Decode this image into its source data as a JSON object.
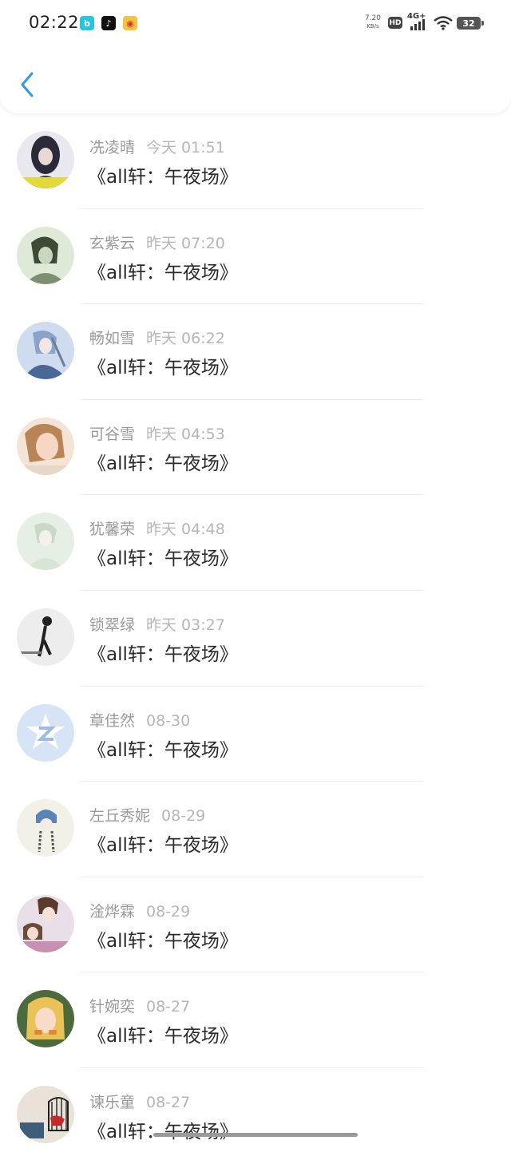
{
  "status_bar": {
    "time": "02:22",
    "apps": [
      "b",
      "♪",
      "◉"
    ],
    "net_speed_value": "7.20",
    "net_speed_unit": "KB/s",
    "hd": "HD",
    "network": "4G+",
    "battery": "32"
  },
  "header": {
    "back_icon": "chevron-left-icon",
    "accent": "#2f9be8"
  },
  "messages": [
    {
      "name": "冼凌晴",
      "time": "今天 01:51",
      "text": "《all轩：午夜场》",
      "avatar": "avatar-dark-haired-girl"
    },
    {
      "name": "玄紫云",
      "time": "昨天 07:20",
      "text": "《all轩：午夜场》",
      "avatar": "avatar-green-sketch"
    },
    {
      "name": "畅如雪",
      "time": "昨天 06:22",
      "text": "《all轩：午夜场》",
      "avatar": "avatar-blue-anime"
    },
    {
      "name": "可谷雪",
      "time": "昨天 04:53",
      "text": "《all轩：午夜场》",
      "avatar": "avatar-selfie-girl"
    },
    {
      "name": "犹馨荣",
      "time": "昨天 04:48",
      "text": "《all轩：午夜场》",
      "avatar": "avatar-pale-green-art"
    },
    {
      "name": "锁翠绿",
      "time": "昨天 03:27",
      "text": "《all轩：午夜场》",
      "avatar": "avatar-bw-figure"
    },
    {
      "name": "章佳然",
      "time": "08-30",
      "text": "《all轩：午夜场》",
      "avatar": "avatar-qq-default"
    },
    {
      "name": "左丘秀妮",
      "time": "08-29",
      "text": "《all轩：午夜场》",
      "avatar": "avatar-braided-girl"
    },
    {
      "name": "淦烨霖",
      "time": "08-29",
      "text": "《all轩：午夜场》",
      "avatar": "avatar-anime-couple"
    },
    {
      "name": "针婉奕",
      "time": "08-27",
      "text": "《all轩：午夜场》",
      "avatar": "avatar-blonde-anime"
    },
    {
      "name": "谏乐童",
      "time": "08-27",
      "text": "《all轩：午夜场》",
      "avatar": "avatar-birdcage"
    }
  ]
}
